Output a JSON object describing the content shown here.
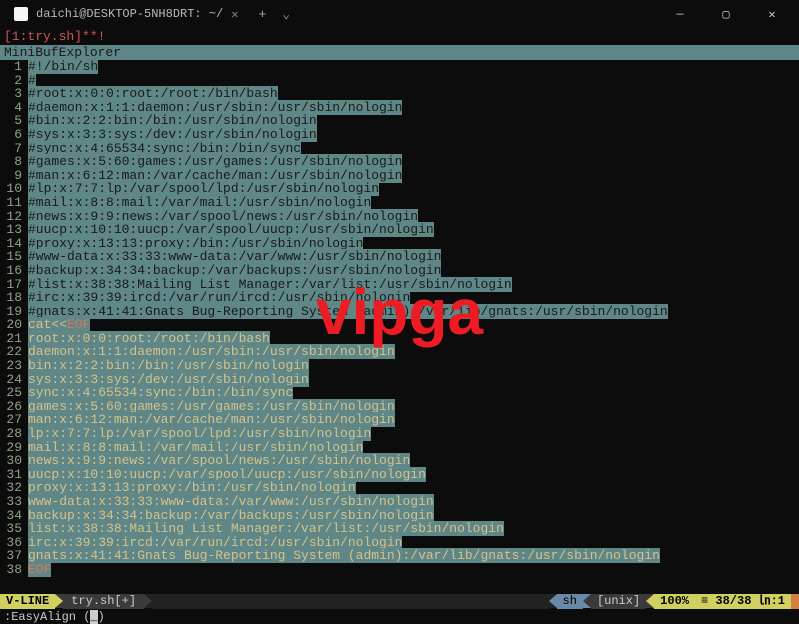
{
  "titlebar": {
    "tab_title": "daichi@DESKTOP-5NH8DRT: ~/",
    "new_tab": "+",
    "dropdown": "⌄",
    "min": "—",
    "max": "▢",
    "close": "✕"
  },
  "bufline": "[1:try.sh]**!",
  "minibuf": "MiniBufExplorer",
  "lines": [
    {
      "n": 1,
      "cls": "sel-comment",
      "text": "#!/bin/sh"
    },
    {
      "n": 2,
      "cls": "sel-comment",
      "text": "#"
    },
    {
      "n": 3,
      "cls": "sel-comment",
      "text": "#root:x:0:0:root:/root:/bin/bash"
    },
    {
      "n": 4,
      "cls": "sel-comment",
      "text": "#daemon:x:1:1:daemon:/usr/sbin:/usr/sbin/nologin"
    },
    {
      "n": 5,
      "cls": "sel-comment",
      "text": "#bin:x:2:2:bin:/bin:/usr/sbin/nologin"
    },
    {
      "n": 6,
      "cls": "sel-comment",
      "text": "#sys:x:3:3:sys:/dev:/usr/sbin/nologin"
    },
    {
      "n": 7,
      "cls": "sel-comment",
      "text": "#sync:x:4:65534:sync:/bin:/bin/sync"
    },
    {
      "n": 8,
      "cls": "sel-comment",
      "text": "#games:x:5:60:games:/usr/games:/usr/sbin/nologin"
    },
    {
      "n": 9,
      "cls": "sel-comment",
      "text": "#man:x:6:12:man:/var/cache/man:/usr/sbin/nologin"
    },
    {
      "n": 10,
      "cls": "sel-comment",
      "text": "#lp:x:7:7:lp:/var/spool/lpd:/usr/sbin/nologin"
    },
    {
      "n": 11,
      "cls": "sel-comment",
      "text": "#mail:x:8:8:mail:/var/mail:/usr/sbin/nologin"
    },
    {
      "n": 12,
      "cls": "sel-comment",
      "text": "#news:x:9:9:news:/var/spool/news:/usr/sbin/nologin"
    },
    {
      "n": 13,
      "cls": "sel-comment",
      "text": "#uucp:x:10:10:uucp:/var/spool/uucp:/usr/sbin/nologin"
    },
    {
      "n": 14,
      "cls": "sel-comment",
      "text": "#proxy:x:13:13:proxy:/bin:/usr/sbin/nologin"
    },
    {
      "n": 15,
      "cls": "sel-comment",
      "text": "#www-data:x:33:33:www-data:/var/www:/usr/sbin/nologin"
    },
    {
      "n": 16,
      "cls": "sel-comment",
      "text": "#backup:x:34:34:backup:/var/backups:/usr/sbin/nologin"
    },
    {
      "n": 17,
      "cls": "sel-comment",
      "text": "#list:x:38:38:Mailing List Manager:/var/list:/usr/sbin/nologin"
    },
    {
      "n": 18,
      "cls": "sel-comment",
      "text": "#irc:x:39:39:ircd:/var/run/ircd:/usr/sbin/nologin"
    },
    {
      "n": 19,
      "cls": "sel-comment",
      "text": "#gnats:x:41:41:Gnats Bug-Reporting System (admin):/var/lib/gnats:/usr/sbin/nologin"
    },
    {
      "n": 20,
      "cls": "sel-cmd",
      "text": "cat<<EOF",
      "eof": true
    },
    {
      "n": 21,
      "cls": "sel-text",
      "text": "root:x:0:0:root:/root:/bin/bash"
    },
    {
      "n": 22,
      "cls": "sel-text",
      "text": "daemon:x:1:1:daemon:/usr/sbin:/usr/sbin/nologin"
    },
    {
      "n": 23,
      "cls": "sel-text",
      "text": "bin:x:2:2:bin:/bin:/usr/sbin/nologin"
    },
    {
      "n": 24,
      "cls": "sel-text",
      "text": "sys:x:3:3:sys:/dev:/usr/sbin/nologin"
    },
    {
      "n": 25,
      "cls": "sel-text",
      "text": "sync:x:4:65534:sync:/bin:/bin/sync"
    },
    {
      "n": 26,
      "cls": "sel-text",
      "text": "games:x:5:60:games:/usr/games:/usr/sbin/nologin"
    },
    {
      "n": 27,
      "cls": "sel-text",
      "text": "man:x:6:12:man:/var/cache/man:/usr/sbin/nologin"
    },
    {
      "n": 28,
      "cls": "sel-text",
      "text": "lp:x:7:7:lp:/var/spool/lpd:/usr/sbin/nologin"
    },
    {
      "n": 29,
      "cls": "sel-text",
      "text": "mail:x:8:8:mail:/var/mail:/usr/sbin/nologin"
    },
    {
      "n": 30,
      "cls": "sel-text",
      "text": "news:x:9:9:news:/var/spool/news:/usr/sbin/nologin"
    },
    {
      "n": 31,
      "cls": "sel-text",
      "text": "uucp:x:10:10:uucp:/var/spool/uucp:/usr/sbin/nologin"
    },
    {
      "n": 32,
      "cls": "sel-text",
      "text": "proxy:x:13:13:proxy:/bin:/usr/sbin/nologin"
    },
    {
      "n": 33,
      "cls": "sel-text",
      "text": "www-data:x:33:33:www-data:/var/www:/usr/sbin/nologin"
    },
    {
      "n": 34,
      "cls": "sel-text",
      "text": "backup:x:34:34:backup:/var/backups:/usr/sbin/nologin"
    },
    {
      "n": 35,
      "cls": "sel-text",
      "text": "list:x:38:38:Mailing List Manager:/var/list:/usr/sbin/nologin"
    },
    {
      "n": 36,
      "cls": "sel-text",
      "text": "irc:x:39:39:ircd:/var/run/ircd:/usr/sbin/nologin"
    },
    {
      "n": 37,
      "cls": "sel-text",
      "text": "gnats:x:41:41:Gnats Bug-Reporting System (admin):/var/lib/gnats:/usr/sbin/nologin"
    },
    {
      "n": 38,
      "cls": "sel-eof",
      "text": "EOF"
    }
  ],
  "statusbar": {
    "mode": "V-LINE",
    "file": "try.sh[+]",
    "filetype": "sh",
    "encoding": "[unix]",
    "percent": "100%",
    "position": "≡ 38/38 ㏑:1",
    "warn": " "
  },
  "cmdline_prefix": ":EasyAlign (",
  "cmdline_cursor": "_",
  "cmdline_suffix": ")",
  "watermark": "vipga"
}
